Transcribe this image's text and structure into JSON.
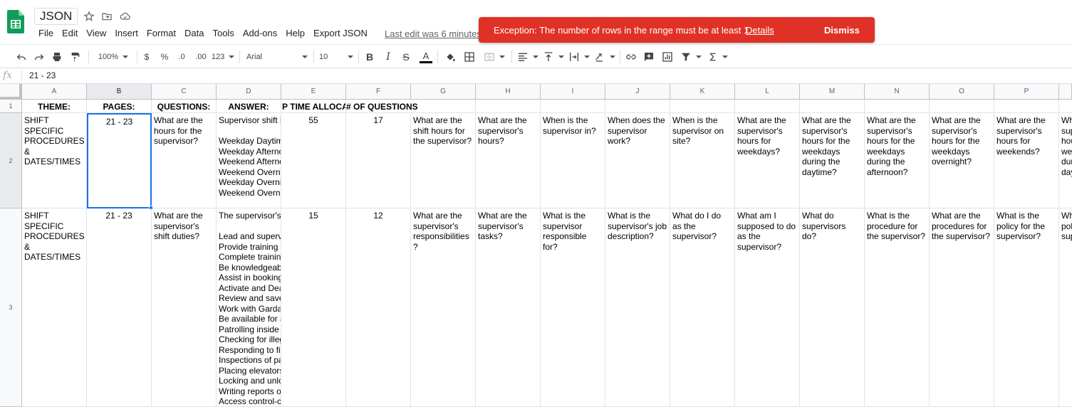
{
  "app": {
    "title": "JSON",
    "last_edit": "Last edit was 6 minutes ago",
    "colors": {
      "accent": "#1a73e8",
      "toast": "#e03127",
      "sheets_green": "#0f9d58"
    }
  },
  "menu": [
    "File",
    "Edit",
    "View",
    "Insert",
    "Format",
    "Data",
    "Tools",
    "Add-ons",
    "Help",
    "Export JSON"
  ],
  "toast": {
    "message": "Exception: The number of rows in the range must be at least 1.",
    "details": "Details",
    "dismiss": "Dismiss"
  },
  "toolbar": {
    "zoom": "100%",
    "currency": "$",
    "percent": "%",
    "dec_decrease": ".0",
    "dec_increase": ".00",
    "more_formats": "123",
    "font": "Arial",
    "font_size": "10",
    "bold": "B",
    "italic": "I",
    "strike": "S",
    "text_color": "A"
  },
  "formula_bar": {
    "fx": "fx",
    "value": "21 - 23"
  },
  "grid": {
    "columns": [
      "A",
      "B",
      "C",
      "D",
      "E",
      "F",
      "G",
      "H",
      "I",
      "J",
      "K",
      "L",
      "M",
      "N",
      "O",
      "P",
      ""
    ],
    "rows": [
      "1",
      "2",
      "3"
    ],
    "header_row": [
      "THEME:",
      "PAGES:",
      "QUESTIONS:",
      "ANSWER:",
      "P TIME ALLOCA",
      "# OF QUESTIONS"
    ],
    "row2": {
      "A": "SHIFT\nSPECIFIC\nPROCEDURES\n&\nDATES/TIMES",
      "B": "21 - 23",
      "C": "What are the hours for the supervisor?",
      "D": "Supervisor shift h\n\nWeekday Daytim\nWeekday Afterno\nWeekend Afterno\nWeekend Overni\nWeekday Overnig\nWeekend Overni",
      "E": "55",
      "F": "17",
      "G": "What are the shift hours for the supervisor?",
      "H": "What are the supervisor's hours?",
      "I": "When is the supervisor in?",
      "J": "When does the supervisor work?",
      "K": "When is the supervisor on site?",
      "L": "What are the supervisor's hours for weekdays?",
      "M": "What are the supervisor's hours for the weekdays during the daytime?",
      "N": "What are the supervisor's hours for the weekdays during the afternoon?",
      "O": "What are the supervisor's hours for the weekdays overnight?",
      "P": "What are the supervisor's hours for weekends?",
      "Q": "Wh\nsup\nhou\nwe\ndur\nday"
    },
    "row3": {
      "A": "SHIFT\nSPECIFIC\nPROCEDURES\n&\nDATES/TIMES",
      "B": "21 - 23",
      "C": "What are the supervisor's shift duties?",
      "D": "The supervisor's\n\nLead and superv\nProvide training t\nComplete training\nBe knowledgeab\nAssist in booking\nActivate and Dea\nReview and save\nWork with Garda'\nBe available for a\nPatrolling inside a\nChecking for illeg\nResponding to fir\nInspections of pa\nPlacing elevators\nLocking and unlo\nWriting reports o\nAccess control-c",
      "E": "15",
      "F": "12",
      "G": "What are the supervisor's responsibilities?",
      "H": "What are the supervisor's tasks?",
      "I": "What is the supervisor responsible for?",
      "J": "What is the supervisor's job description?",
      "K": "What do I do as the supervisor?",
      "L": "What am I supposed to do as the supervisor?",
      "M": "What do supervisors do?",
      "N": "What is the procedure for the supervisor?",
      "O": "What are the procedures for the supervisor?",
      "P": "What is the policy for the supervisor?",
      "Q": "Wh\npol\nsup"
    }
  }
}
